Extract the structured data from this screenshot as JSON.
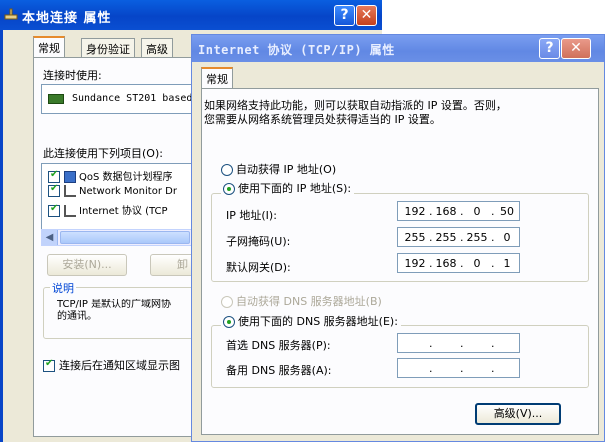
{
  "back_window": {
    "title": "本地连接 属性",
    "help_label": "?",
    "close_label": "✕",
    "tabs": [
      "常规",
      "身份验证",
      "高级"
    ],
    "connect_using_label": "连接时使用:",
    "adapter_name": "Sundance ST201 based",
    "items_label": "此连接使用下列项目(O):",
    "items": [
      {
        "label": "QoS 数据包计划程序",
        "checked": true
      },
      {
        "label": "Network Monitor Dr",
        "checked": true
      },
      {
        "label": "Internet 协议 (TCP",
        "checked": true
      }
    ],
    "install_label": "安装(N)...",
    "uninstall_label": "卸",
    "description_legend": "说明",
    "description_lines": [
      "TCP/IP 是默认的广域网协",
      "的通讯。"
    ],
    "notify_label": "连接后在通知区域显示图"
  },
  "dialog": {
    "title": "Internet 协议 (TCP/IP) 属性",
    "help_label": "?",
    "close_label": "✕",
    "tab_general": "常规",
    "intro_lines": [
      "如果网络支持此功能，则可以获取自动指派的 IP 设置。否则，",
      "您需要从网络系统管理员处获得适当的 IP 设置。"
    ],
    "ip_auto_label": "自动获得 IP 地址(O)",
    "ip_manual_label": "使用下面的 IP 地址(S):",
    "ip_address_label": "IP 地址(I):",
    "subnet_label": "子网掩码(U):",
    "gateway_label": "默认网关(D):",
    "ip_address": [
      "192",
      "168",
      "0",
      "50"
    ],
    "subnet_mask": [
      "255",
      "255",
      "255",
      "0"
    ],
    "gateway": [
      "192",
      "168",
      "0",
      "1"
    ],
    "dns_auto_label": "自动获得 DNS 服务器地址(B)",
    "dns_manual_label": "使用下面的 DNS 服务器地址(E):",
    "preferred_dns_label": "首选 DNS 服务器(P):",
    "alternate_dns_label": "备用 DNS 服务器(A):",
    "advanced_label": "高级(V)..."
  }
}
